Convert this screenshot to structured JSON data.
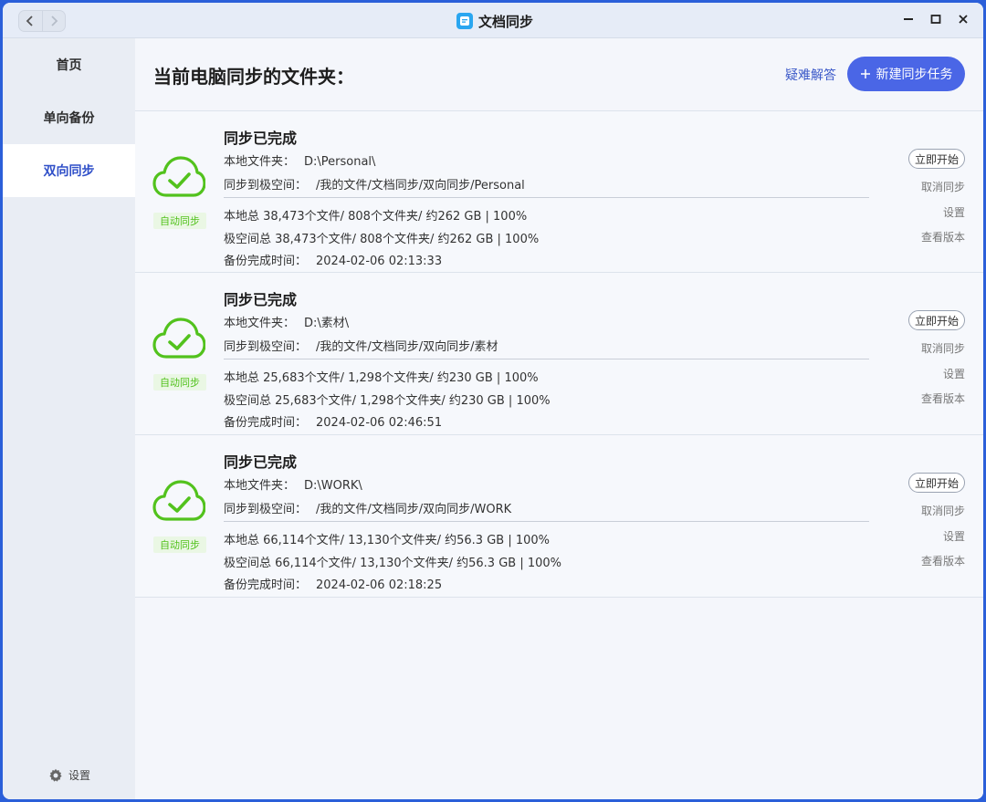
{
  "window": {
    "title": "文档同步"
  },
  "sidebar": {
    "items": [
      {
        "label": "首页"
      },
      {
        "label": "单向备份"
      },
      {
        "label": "双向同步"
      }
    ],
    "settings_label": "设置"
  },
  "header": {
    "title": "当前电脑同步的文件夹：",
    "faq_label": "疑难解答",
    "new_task_label": "新建同步任务"
  },
  "labels": {
    "local_folder": "本地文件夹：",
    "sync_to": "同步到极空间：",
    "backup_time": "备份完成时间："
  },
  "tasks": [
    {
      "status": "同步已完成",
      "badge": "自动同步",
      "local_folder": "D:\\Personal\\",
      "remote_path": "/我的文件/文档同步/双向同步/Personal",
      "local_total": "本地总 38,473个文件/ 808个文件夹/ 约262 GB | 100%",
      "remote_total": "极空间总 38,473个文件/ 808个文件夹/ 约262 GB | 100%",
      "backup_time": "2024-02-06 02:13:33",
      "start_label": "立即开始",
      "cancel_label": "取消同步",
      "settings_label": "设置",
      "versions_label": "查看版本"
    },
    {
      "status": "同步已完成",
      "badge": "自动同步",
      "local_folder": "D:\\素材\\",
      "remote_path": "/我的文件/文档同步/双向同步/素材",
      "local_total": "本地总 25,683个文件/ 1,298个文件夹/ 约230 GB | 100%",
      "remote_total": "极空间总 25,683个文件/ 1,298个文件夹/ 约230 GB | 100%",
      "backup_time": "2024-02-06 02:46:51",
      "start_label": "立即开始",
      "cancel_label": "取消同步",
      "settings_label": "设置",
      "versions_label": "查看版本"
    },
    {
      "status": "同步已完成",
      "badge": "自动同步",
      "local_folder": "D:\\WORK\\",
      "remote_path": "/我的文件/文档同步/双向同步/WORK",
      "local_total": "本地总 66,114个文件/ 13,130个文件夹/ 约56.3 GB | 100%",
      "remote_total": "极空间总 66,114个文件/ 13,130个文件夹/ 约56.3 GB | 100%",
      "backup_time": "2024-02-06 02:18:25",
      "start_label": "立即开始",
      "cancel_label": "取消同步",
      "settings_label": "设置",
      "versions_label": "查看版本"
    }
  ],
  "colors": {
    "accent": "#4a66e6",
    "success": "#52c21d",
    "sidebar_active_text": "#2f4fc8"
  },
  "icons": {
    "back": "chevron-left-icon",
    "forward": "chevron-right-icon",
    "app": "document-sync-icon",
    "minimize": "minimize-icon",
    "maximize": "maximize-icon",
    "close": "close-icon",
    "settings": "gear-icon",
    "plus": "plus-icon",
    "cloud_check": "cloud-check-icon"
  }
}
